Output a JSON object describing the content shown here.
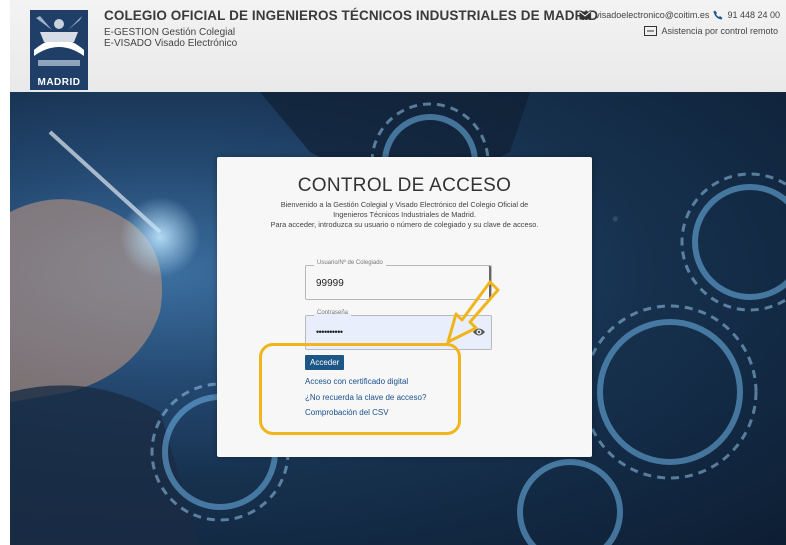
{
  "header": {
    "logo_text": "MADRID",
    "org_title": "COLEGIO OFICIAL DE INGENIEROS TÉCNICOS INDUSTRIALES DE MADRID",
    "subtitle_gestion": "E-GESTION Gestión Colegial",
    "subtitle_visado": "E-VISADO Visado Electrónico",
    "email": "visadoelectronico@coitim.es",
    "phone": "91 448 24 00",
    "remote_assistance": "Asistencia por control remoto"
  },
  "login": {
    "title": "CONTROL DE ACCESO",
    "description_line1": "Bienvenido a la Gestión Colegial y Visado Electrónico del Colegio Oficial de",
    "description_line2": "Ingenieros Técnicos Industriales de Madrid.",
    "description_line3": "Para acceder, introduzca su usuario o número de colegiado y su clave de acceso.",
    "user_label": "Usuario/Nº de Colegiado",
    "user_value": "99999",
    "password_label": "Contraseña",
    "password_value": "••••••••••",
    "submit_label": "Acceder",
    "cert_link": "Acceso con certificado digital",
    "forgot_link": "¿No recuerda la clave de acceso?",
    "csv_link": "Comprobación del CSV"
  },
  "colors": {
    "highlight": "#f1b51c",
    "button": "#1c5787",
    "link": "#1a4f8a",
    "logo": "#1f3f69"
  },
  "icons": [
    "envelope-icon",
    "phone-icon",
    "remote-screen-icon",
    "eye-icon",
    "arrow-annotation-icon"
  ]
}
